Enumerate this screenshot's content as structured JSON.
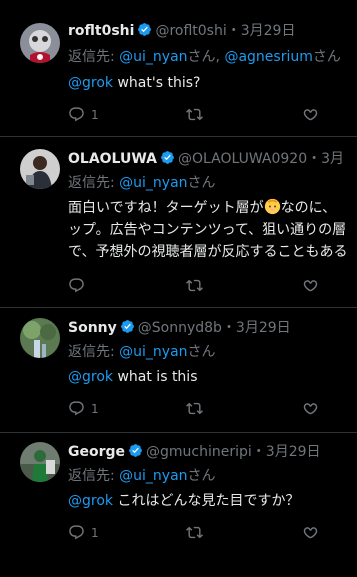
{
  "tweets": [
    {
      "name": "roflt0shi",
      "handle": "@roflt0shi",
      "date": "・3月29日",
      "reply_label": "返信先: ",
      "reply_to": "@ui_nyan",
      "reply_suffix": "さん, ",
      "reply_to2": "@agnesrium",
      "reply_suffix2": "さん",
      "mention": "@grok",
      "text": " what's this?",
      "reply_count": "1"
    },
    {
      "name": "OLAOLUWA",
      "handle": "@OLAOLUWA0920",
      "date": "・3月",
      "reply_label": "返信先: ",
      "reply_to": "@ui_nyan",
      "reply_suffix": "さん",
      "lines": [
        "面白いですね！ターゲット層が",
        "なのに、",
        "ップ。広告やコンテンツって、狙い通りの層",
        "で、予想外の視聴者層が反応することもある"
      ],
      "emoji": "baby-face-emoji"
    },
    {
      "name": "Sonny",
      "handle": "@Sonnyd8b",
      "date": "・3月29日",
      "reply_label": "返信先: ",
      "reply_to": "@ui_nyan",
      "reply_suffix": "さん",
      "mention": "@grok",
      "text": " what is this",
      "reply_count": "1"
    },
    {
      "name": "George",
      "handle": "@gmuchineripi",
      "date": "・3月29日",
      "reply_label": "返信先: ",
      "reply_to": "@ui_nyan",
      "reply_suffix": "さん",
      "mention": "@grok",
      "text": " これはどんな見た目ですか？",
      "reply_count": "1"
    }
  ],
  "colors": {
    "background": "#000000",
    "link": "#1d9bf0",
    "muted": "#71767b",
    "divider": "#2f3336",
    "verified": "#1d9bf0"
  }
}
